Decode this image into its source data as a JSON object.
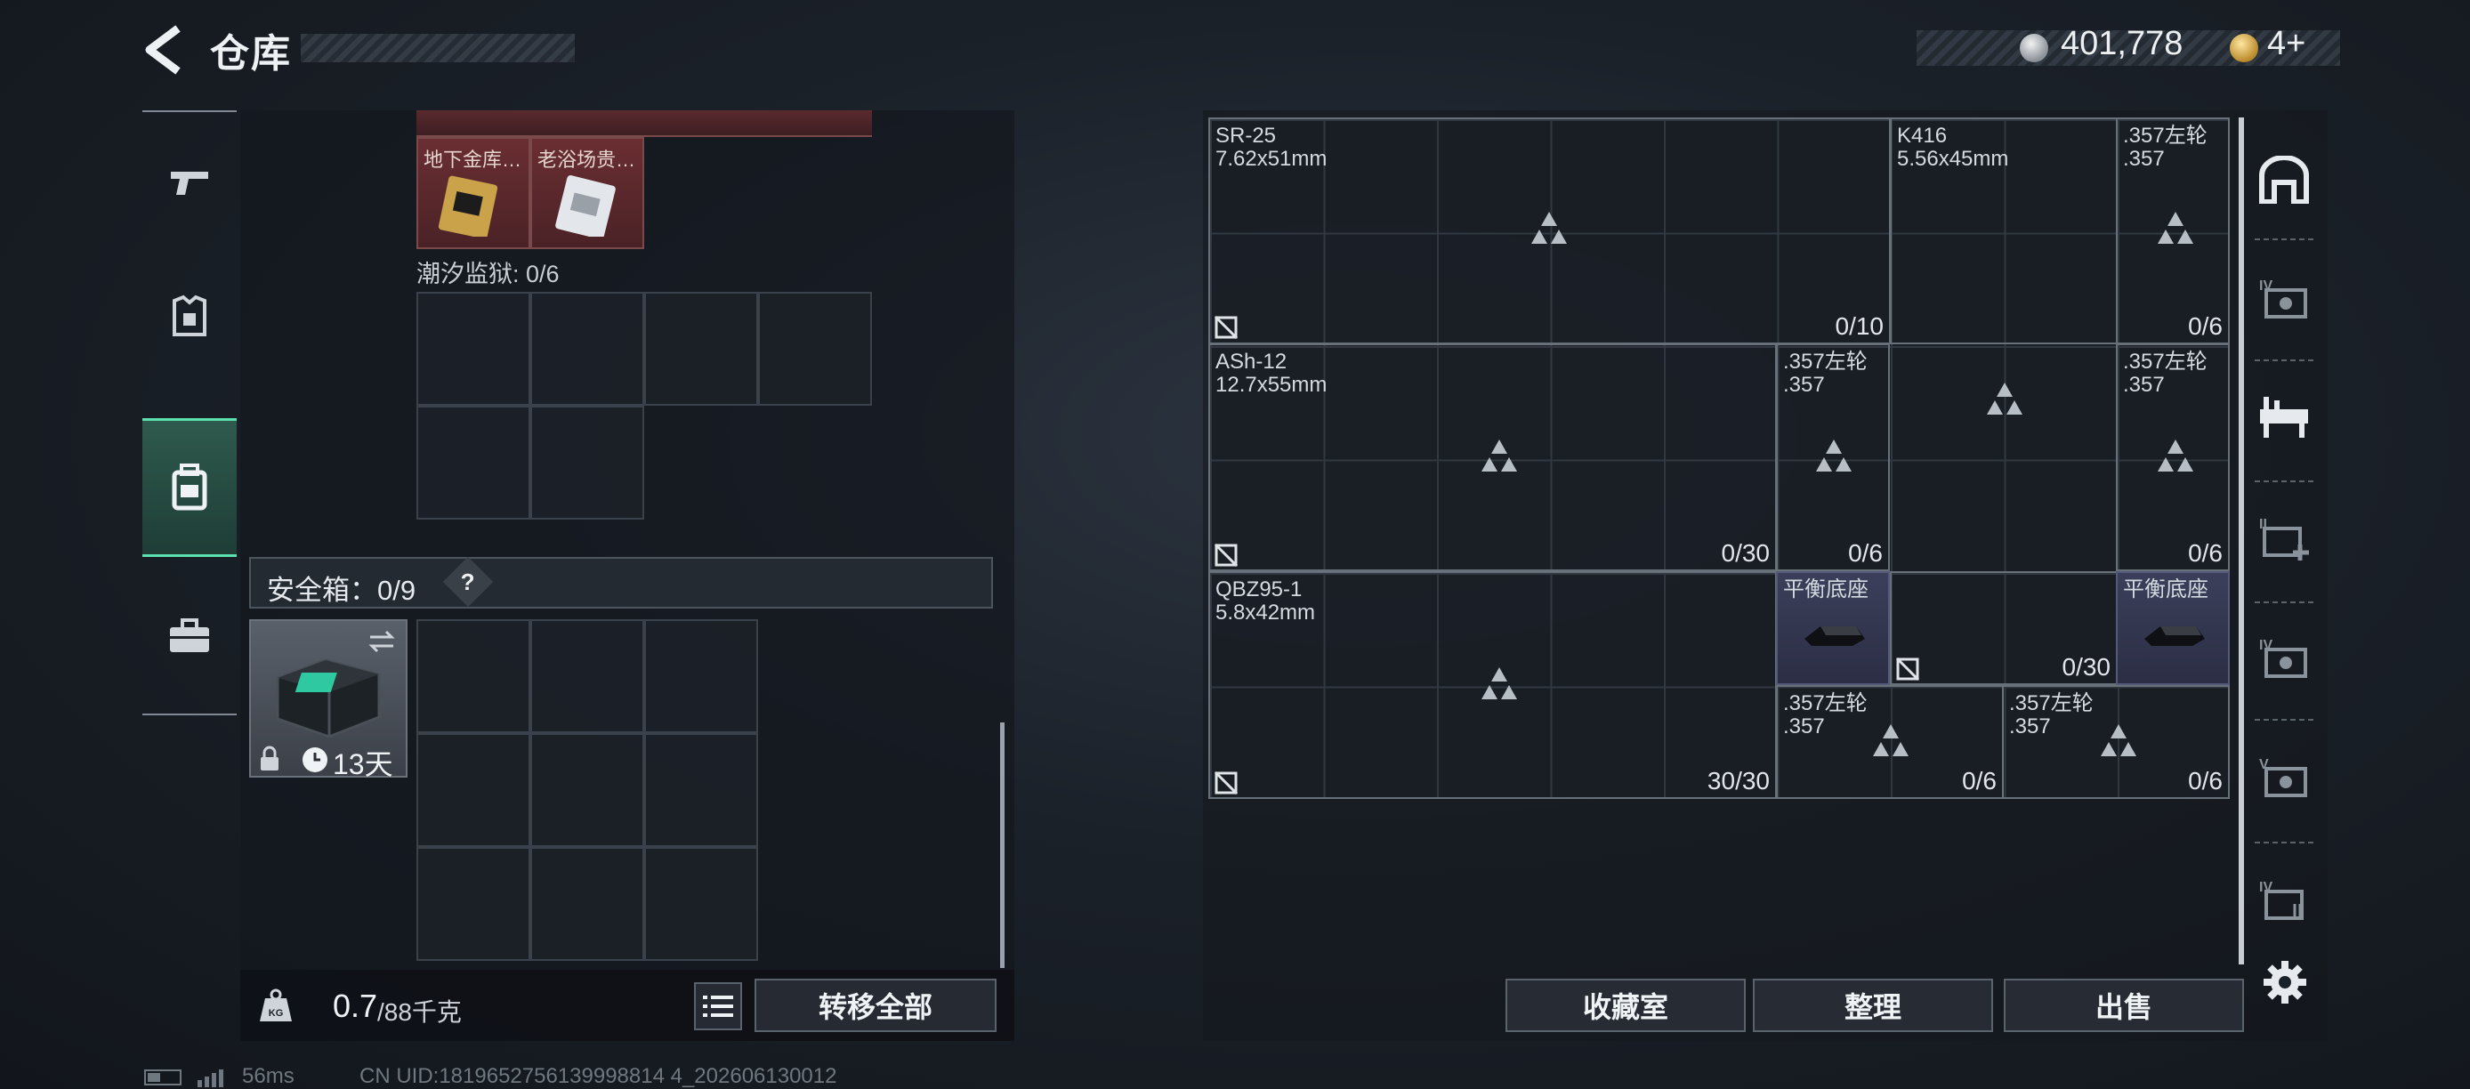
{
  "header": {
    "title": "仓库",
    "silver_amount": "401,778",
    "gold_amount": "4+"
  },
  "left_nav": {
    "items": [
      "gun-icon",
      "armor-icon",
      "backpack-icon",
      "briefcase-icon"
    ],
    "active": "backpack-icon"
  },
  "left_panel": {
    "items": [
      {
        "label": "地下金库…"
      },
      {
        "label": "老浴场贵…"
      }
    ],
    "tidal_prison": {
      "label": "潮汐监狱",
      "count": "0/6"
    },
    "safe_box": {
      "label": "安全箱",
      "count": "0/9",
      "help": "?",
      "duration": "13天"
    },
    "weight": {
      "current": "0.7",
      "max": "/88千克"
    },
    "transfer_all": "转移全部"
  },
  "grid": {
    "boxes": [
      {
        "name": "SR-25",
        "caliber": "7.62x51mm",
        "count": "0/10"
      },
      {
        "name": "K416",
        "caliber": "5.56x45mm",
        "count": ""
      },
      {
        "name": ".357左轮",
        "caliber": ".357",
        "count": "0/6"
      },
      {
        "name": "ASh-12",
        "caliber": "12.7x55mm",
        "count": "0/30"
      },
      {
        "name": ".357左轮",
        "caliber": ".357",
        "count": "0/6"
      },
      {
        "name": ".357左轮",
        "caliber": ".357",
        "count": "0/6"
      },
      {
        "name": "QBZ95-1",
        "caliber": "5.8x42mm",
        "count": "30/30"
      },
      {
        "name": "平衡底座",
        "caliber": "",
        "count": "0/30"
      },
      {
        "name": "平衡底座",
        "caliber": "",
        "count": ""
      },
      {
        "name": ".357左轮",
        "caliber": ".357",
        "count": "0/6"
      },
      {
        "name": ".357左轮",
        "caliber": ".357",
        "count": "0/6"
      }
    ]
  },
  "right_buttons": {
    "collection": "收藏室",
    "organize": "整理",
    "sell": "出售"
  },
  "right_nav": {
    "items": [
      "vault-icon",
      "iv-case-icon",
      "workbench-icon",
      "ii-medkit-icon",
      "iv-case-icon",
      "v-case-icon",
      "iv-bag-icon"
    ]
  },
  "footer": {
    "ping": "56ms",
    "uid": "CN UID:1819652756139998814 4_202606130012"
  }
}
